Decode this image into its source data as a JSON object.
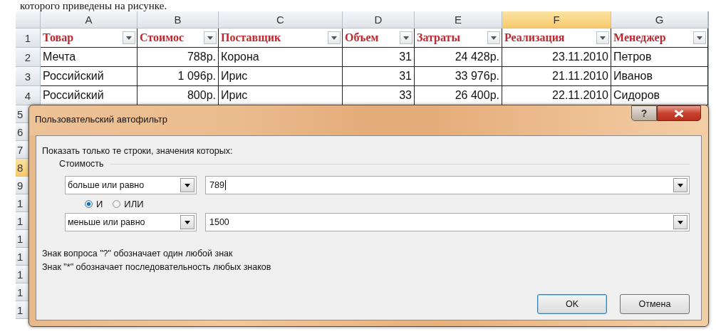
{
  "caption_above": "которого приведены на рисунке.",
  "sheet": {
    "columns": [
      {
        "letter": "A",
        "header": "Товар",
        "kind": "text",
        "selected": false
      },
      {
        "letter": "B",
        "header": "Стоимос",
        "kind": "number",
        "selected": false
      },
      {
        "letter": "C",
        "header": "Поставщик",
        "kind": "text",
        "selected": false
      },
      {
        "letter": "D",
        "header": "Объем",
        "kind": "number",
        "selected": false
      },
      {
        "letter": "E",
        "header": "Затраты",
        "kind": "number",
        "selected": false
      },
      {
        "letter": "F",
        "header": "Реализация",
        "kind": "number",
        "selected": true
      },
      {
        "letter": "G",
        "header": "Менеджер",
        "kind": "text",
        "selected": false
      }
    ],
    "rows": [
      {
        "number": "1",
        "selected": false,
        "kind": "header"
      },
      {
        "number": "2",
        "selected": false,
        "kind": "data",
        "cells": [
          "Мечта",
          "788р.",
          "Корона",
          "31",
          "24 428р.",
          "23.11.2010",
          "Петров"
        ]
      },
      {
        "number": "3",
        "selected": false,
        "kind": "data",
        "cells": [
          "Российский",
          "1 096р.",
          "Ирис",
          "31",
          "33 976р.",
          "21.11.2010",
          "Иванов"
        ]
      },
      {
        "number": "4",
        "selected": false,
        "kind": "data",
        "cells": [
          "Российский",
          "800р.",
          "Ирис",
          "33",
          "26 400р.",
          "22.11.2010",
          "Сидоров"
        ]
      },
      {
        "number": "5",
        "selected": false,
        "kind": "hidden"
      },
      {
        "number": "6",
        "selected": false,
        "kind": "hidden"
      },
      {
        "number": "7",
        "selected": false,
        "kind": "hidden"
      },
      {
        "number": "8",
        "selected": true,
        "kind": "hidden"
      },
      {
        "number": "9",
        "selected": false,
        "kind": "hidden"
      },
      {
        "number": "1",
        "selected": false,
        "kind": "hidden"
      },
      {
        "number": "1",
        "selected": false,
        "kind": "hidden"
      },
      {
        "number": "1",
        "selected": false,
        "kind": "hidden"
      },
      {
        "number": "1",
        "selected": false,
        "kind": "hidden"
      },
      {
        "number": "1",
        "selected": false,
        "kind": "hidden"
      },
      {
        "number": "1",
        "selected": false,
        "kind": "hidden"
      },
      {
        "number": "1",
        "selected": false,
        "kind": "hidden"
      }
    ]
  },
  "dialog": {
    "title": "Пользовательский автофильтр",
    "prompt": "Показать только те строки, значения которых:",
    "group_label": "Стоимость",
    "conditions": [
      {
        "operator": "больше или равно",
        "value": "789"
      },
      {
        "operator": "меньше или равно",
        "value": "1500"
      }
    ],
    "logic": [
      {
        "label": "И",
        "selected": true
      },
      {
        "label": "ИЛИ",
        "selected": false
      }
    ],
    "notes": [
      "Знак вопроса \"?\" обозначает один любой знак",
      "Знак \"*\" обозначает последовательность любых знаков"
    ],
    "buttons": [
      {
        "label": "OK",
        "default": true
      },
      {
        "label": "Отмена",
        "default": false
      }
    ],
    "help_button": "?"
  }
}
